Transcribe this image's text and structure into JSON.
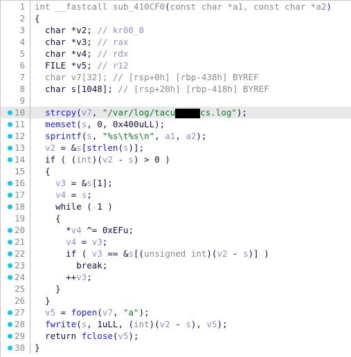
{
  "view": {
    "name": "pseudocode-view",
    "title": "Decompiler Pseudocode",
    "total_lines": 30,
    "highlighted_line": 10,
    "colors": {
      "background": "#ffffff",
      "highlight_row": "#e8e8e8",
      "breakpoint_dot": "#17c3f0",
      "line_number": "#8a8a8a",
      "gutter_divider": "#b9b9b9",
      "keyword": "#0d0d52",
      "type": "#8a8a8a",
      "comment": "#8f8fd6",
      "variable": "#8f8fd6",
      "function_call": "#1a1aff",
      "string": "#0a7a28",
      "redaction": "#000000"
    }
  },
  "lines": [
    {
      "number": "1",
      "breakpoint": false,
      "highlighted": false,
      "tokens": [
        {
          "t": "int ",
          "c": "tok-type"
        },
        {
          "t": "__fastcall ",
          "c": "tok-type"
        },
        {
          "t": "sub_410CF0",
          "c": "tok-func"
        },
        {
          "t": "(",
          "c": "tok-paren"
        },
        {
          "t": "const char *a1, const char *a2",
          "c": "tok-type"
        },
        {
          "t": ")",
          "c": "tok-paren"
        }
      ]
    },
    {
      "number": "2",
      "breakpoint": false,
      "highlighted": false,
      "tokens": [
        {
          "t": "{",
          "c": "tok-punc"
        }
      ]
    },
    {
      "number": "3",
      "breakpoint": false,
      "highlighted": false,
      "tokens": [
        {
          "t": "  char *v2; ",
          "c": "tok-plain"
        },
        {
          "t": "// kr00_8",
          "c": "tok-comment"
        }
      ]
    },
    {
      "number": "4",
      "breakpoint": false,
      "highlighted": false,
      "tokens": [
        {
          "t": "  char *v3; ",
          "c": "tok-plain"
        },
        {
          "t": "// rax",
          "c": "tok-comment"
        }
      ]
    },
    {
      "number": "5",
      "breakpoint": false,
      "highlighted": false,
      "tokens": [
        {
          "t": "  char *v4; ",
          "c": "tok-plain"
        },
        {
          "t": "// rdx",
          "c": "tok-comment"
        }
      ]
    },
    {
      "number": "6",
      "breakpoint": false,
      "highlighted": false,
      "tokens": [
        {
          "t": "  FILE *v5; ",
          "c": "tok-plain"
        },
        {
          "t": "// r12",
          "c": "tok-comment"
        }
      ]
    },
    {
      "number": "7",
      "breakpoint": false,
      "highlighted": false,
      "tokens": [
        {
          "t": "  char v7[32]; ",
          "c": "tok-dim"
        },
        {
          "t": "// [rsp+0h] [rbp-438h] BYREF",
          "c": "tok-dim"
        }
      ]
    },
    {
      "number": "8",
      "breakpoint": false,
      "highlighted": false,
      "tokens": [
        {
          "t": "  char s[1048]; ",
          "c": "tok-plain"
        },
        {
          "t": "// [rsp+20h] [rbp-418h] BYREF",
          "c": "tok-dim"
        }
      ]
    },
    {
      "number": "9",
      "breakpoint": false,
      "highlighted": false,
      "tokens": []
    },
    {
      "number": "10",
      "breakpoint": true,
      "highlighted": true,
      "tokens": [
        {
          "t": "  ",
          "c": "tok-plain"
        },
        {
          "t": "strcpy",
          "c": "tok-call"
        },
        {
          "t": "(",
          "c": "tok-punc"
        },
        {
          "t": "v7",
          "c": "tok-var"
        },
        {
          "t": ", ",
          "c": "tok-punc"
        },
        {
          "t": "\"/var/log/tacu",
          "c": "tok-string"
        },
        {
          "t": "",
          "c": "redaction",
          "redaction_width": 36
        },
        {
          "t": "cs.log\"",
          "c": "tok-string"
        },
        {
          "t": ");",
          "c": "tok-punc"
        }
      ]
    },
    {
      "number": "11",
      "breakpoint": true,
      "highlighted": false,
      "tokens": [
        {
          "t": "  ",
          "c": "tok-plain"
        },
        {
          "t": "memset",
          "c": "tok-call"
        },
        {
          "t": "(",
          "c": "tok-punc"
        },
        {
          "t": "s",
          "c": "tok-var"
        },
        {
          "t": ", ",
          "c": "tok-punc"
        },
        {
          "t": "0",
          "c": "tok-num"
        },
        {
          "t": ", ",
          "c": "tok-punc"
        },
        {
          "t": "0x400uLL",
          "c": "tok-num"
        },
        {
          "t": ");",
          "c": "tok-punc"
        }
      ]
    },
    {
      "number": "12",
      "breakpoint": true,
      "highlighted": false,
      "tokens": [
        {
          "t": "  ",
          "c": "tok-plain"
        },
        {
          "t": "sprintf",
          "c": "tok-call"
        },
        {
          "t": "(",
          "c": "tok-punc"
        },
        {
          "t": "s",
          "c": "tok-var"
        },
        {
          "t": ", ",
          "c": "tok-punc"
        },
        {
          "t": "\"%s\\t%s\\n\"",
          "c": "tok-string"
        },
        {
          "t": ", ",
          "c": "tok-punc"
        },
        {
          "t": "a1",
          "c": "tok-var"
        },
        {
          "t": ", ",
          "c": "tok-punc"
        },
        {
          "t": "a2",
          "c": "tok-var"
        },
        {
          "t": ");",
          "c": "tok-punc"
        }
      ]
    },
    {
      "number": "13",
      "breakpoint": true,
      "highlighted": false,
      "tokens": [
        {
          "t": "  ",
          "c": "tok-plain"
        },
        {
          "t": "v2",
          "c": "tok-var"
        },
        {
          "t": " = &",
          "c": "tok-punc"
        },
        {
          "t": "s",
          "c": "tok-var"
        },
        {
          "t": "[",
          "c": "tok-punc"
        },
        {
          "t": "strlen",
          "c": "tok-call"
        },
        {
          "t": "(",
          "c": "tok-punc"
        },
        {
          "t": "s",
          "c": "tok-var"
        },
        {
          "t": ")];",
          "c": "tok-punc"
        }
      ]
    },
    {
      "number": "14",
      "breakpoint": true,
      "highlighted": false,
      "tokens": [
        {
          "t": "  if ( (",
          "c": "tok-plain"
        },
        {
          "t": "int",
          "c": "tok-dim"
        },
        {
          "t": ")(",
          "c": "tok-punc"
        },
        {
          "t": "v2",
          "c": "tok-var"
        },
        {
          "t": " - ",
          "c": "tok-punc"
        },
        {
          "t": "s",
          "c": "tok-var"
        },
        {
          "t": ") > ",
          "c": "tok-punc"
        },
        {
          "t": "0",
          "c": "tok-num"
        },
        {
          "t": " )",
          "c": "tok-punc"
        }
      ]
    },
    {
      "number": "15",
      "breakpoint": false,
      "highlighted": false,
      "tokens": [
        {
          "t": "  {",
          "c": "tok-punc"
        }
      ]
    },
    {
      "number": "16",
      "breakpoint": true,
      "highlighted": false,
      "tokens": [
        {
          "t": "    ",
          "c": "tok-plain"
        },
        {
          "t": "v3",
          "c": "tok-var"
        },
        {
          "t": " = &",
          "c": "tok-punc"
        },
        {
          "t": "s",
          "c": "tok-var"
        },
        {
          "t": "[",
          "c": "tok-punc"
        },
        {
          "t": "1",
          "c": "tok-num"
        },
        {
          "t": "];",
          "c": "tok-punc"
        }
      ]
    },
    {
      "number": "17",
      "breakpoint": true,
      "highlighted": false,
      "tokens": [
        {
          "t": "    ",
          "c": "tok-plain"
        },
        {
          "t": "v4",
          "c": "tok-var"
        },
        {
          "t": " = ",
          "c": "tok-punc"
        },
        {
          "t": "s",
          "c": "tok-var"
        },
        {
          "t": ";",
          "c": "tok-punc"
        }
      ]
    },
    {
      "number": "18",
      "breakpoint": true,
      "highlighted": false,
      "tokens": [
        {
          "t": "    while ( ",
          "c": "tok-plain"
        },
        {
          "t": "1",
          "c": "tok-num"
        },
        {
          "t": " )",
          "c": "tok-punc"
        }
      ]
    },
    {
      "number": "19",
      "breakpoint": false,
      "highlighted": false,
      "tokens": [
        {
          "t": "    {",
          "c": "tok-punc"
        }
      ]
    },
    {
      "number": "20",
      "breakpoint": true,
      "highlighted": false,
      "tokens": [
        {
          "t": "      *",
          "c": "tok-punc"
        },
        {
          "t": "v4",
          "c": "tok-var"
        },
        {
          "t": " ^= ",
          "c": "tok-punc"
        },
        {
          "t": "0xEFu",
          "c": "tok-num"
        },
        {
          "t": ";",
          "c": "tok-punc"
        }
      ]
    },
    {
      "number": "21",
      "breakpoint": true,
      "highlighted": false,
      "tokens": [
        {
          "t": "      ",
          "c": "tok-plain"
        },
        {
          "t": "v4",
          "c": "tok-var"
        },
        {
          "t": " = ",
          "c": "tok-punc"
        },
        {
          "t": "v3",
          "c": "tok-var"
        },
        {
          "t": ";",
          "c": "tok-punc"
        }
      ]
    },
    {
      "number": "22",
      "breakpoint": true,
      "highlighted": false,
      "tokens": [
        {
          "t": "      if ( ",
          "c": "tok-plain"
        },
        {
          "t": "v3",
          "c": "tok-var"
        },
        {
          "t": " == &",
          "c": "tok-punc"
        },
        {
          "t": "s",
          "c": "tok-var"
        },
        {
          "t": "[(",
          "c": "tok-punc"
        },
        {
          "t": "unsigned int",
          "c": "tok-dim"
        },
        {
          "t": ")(",
          "c": "tok-punc"
        },
        {
          "t": "v2",
          "c": "tok-var"
        },
        {
          "t": " - ",
          "c": "tok-punc"
        },
        {
          "t": "s",
          "c": "tok-var"
        },
        {
          "t": ")] )",
          "c": "tok-punc"
        }
      ]
    },
    {
      "number": "23",
      "breakpoint": true,
      "highlighted": false,
      "tokens": [
        {
          "t": "        break;",
          "c": "tok-plain"
        }
      ]
    },
    {
      "number": "24",
      "breakpoint": true,
      "highlighted": false,
      "tokens": [
        {
          "t": "      ++",
          "c": "tok-punc"
        },
        {
          "t": "v3",
          "c": "tok-var"
        },
        {
          "t": ";",
          "c": "tok-punc"
        }
      ]
    },
    {
      "number": "25",
      "breakpoint": false,
      "highlighted": false,
      "tokens": [
        {
          "t": "    }",
          "c": "tok-punc"
        }
      ]
    },
    {
      "number": "26",
      "breakpoint": false,
      "highlighted": false,
      "tokens": [
        {
          "t": "  }",
          "c": "tok-punc"
        }
      ]
    },
    {
      "number": "27",
      "breakpoint": true,
      "highlighted": false,
      "tokens": [
        {
          "t": "  ",
          "c": "tok-plain"
        },
        {
          "t": "v5",
          "c": "tok-var"
        },
        {
          "t": " = ",
          "c": "tok-punc"
        },
        {
          "t": "fopen",
          "c": "tok-call"
        },
        {
          "t": "(",
          "c": "tok-punc"
        },
        {
          "t": "v7",
          "c": "tok-var"
        },
        {
          "t": ", ",
          "c": "tok-punc"
        },
        {
          "t": "\"a\"",
          "c": "tok-string"
        },
        {
          "t": ");",
          "c": "tok-punc"
        }
      ]
    },
    {
      "number": "28",
      "breakpoint": true,
      "highlighted": false,
      "tokens": [
        {
          "t": "  ",
          "c": "tok-plain"
        },
        {
          "t": "fwrite",
          "c": "tok-call"
        },
        {
          "t": "(",
          "c": "tok-punc"
        },
        {
          "t": "s",
          "c": "tok-var"
        },
        {
          "t": ", ",
          "c": "tok-punc"
        },
        {
          "t": "1uLL",
          "c": "tok-num"
        },
        {
          "t": ", (",
          "c": "tok-punc"
        },
        {
          "t": "int",
          "c": "tok-dim"
        },
        {
          "t": ")(",
          "c": "tok-punc"
        },
        {
          "t": "v2",
          "c": "tok-var"
        },
        {
          "t": " - ",
          "c": "tok-punc"
        },
        {
          "t": "s",
          "c": "tok-var"
        },
        {
          "t": "), ",
          "c": "tok-punc"
        },
        {
          "t": "v5",
          "c": "tok-var"
        },
        {
          "t": ");",
          "c": "tok-punc"
        }
      ]
    },
    {
      "number": "29",
      "breakpoint": true,
      "highlighted": false,
      "tokens": [
        {
          "t": "  return ",
          "c": "tok-plain"
        },
        {
          "t": "fclose",
          "c": "tok-call"
        },
        {
          "t": "(",
          "c": "tok-punc"
        },
        {
          "t": "v5",
          "c": "tok-var"
        },
        {
          "t": ");",
          "c": "tok-punc"
        }
      ]
    },
    {
      "number": "30",
      "breakpoint": true,
      "highlighted": false,
      "tokens": [
        {
          "t": "}",
          "c": "tok-punc"
        }
      ]
    }
  ]
}
